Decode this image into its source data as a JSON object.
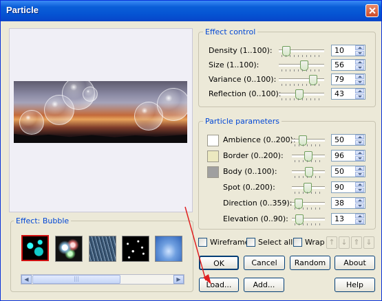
{
  "window": {
    "title": "Particle"
  },
  "effect_control": {
    "heading": "Effect control",
    "rows": [
      {
        "label": "Density (1..100):",
        "value": "10",
        "fraction": 0.09
      },
      {
        "label": "Size (1..100):",
        "value": "56",
        "fraction": 0.55
      },
      {
        "label": "Variance (0..100):",
        "value": "79",
        "fraction": 0.79
      },
      {
        "label": "Reflection (0..100):",
        "value": "43",
        "fraction": 0.43
      }
    ]
  },
  "particle_parameters": {
    "heading": "Particle parameters",
    "rows": [
      {
        "label": "Ambience (0..200):",
        "value": "50",
        "fraction": 0.25,
        "swatch": "#ffffff"
      },
      {
        "label": "Border (0..200):",
        "value": "96",
        "fraction": 0.48,
        "swatch": "#ece9c0"
      },
      {
        "label": "Body (0..100):",
        "value": "50",
        "fraction": 0.5,
        "swatch": "#a0a0a0"
      },
      {
        "label": "Spot (0..200):",
        "value": "90",
        "fraction": 0.45
      },
      {
        "label": "Direction (0..359):",
        "value": "38",
        "fraction": 0.11
      },
      {
        "label": "Elevation (0..90):",
        "value": "13",
        "fraction": 0.14
      }
    ]
  },
  "options": {
    "wireframe": "Wireframe",
    "select_all": "Select all",
    "wrap": "Wrap"
  },
  "effect": {
    "label": "Effect: Bubble"
  },
  "buttons": {
    "ok": "OK",
    "cancel": "Cancel",
    "random": "Random",
    "about": "About",
    "load": "Load...",
    "add": "Add...",
    "help": "Help"
  },
  "scroll_thumb_grip": "|||"
}
